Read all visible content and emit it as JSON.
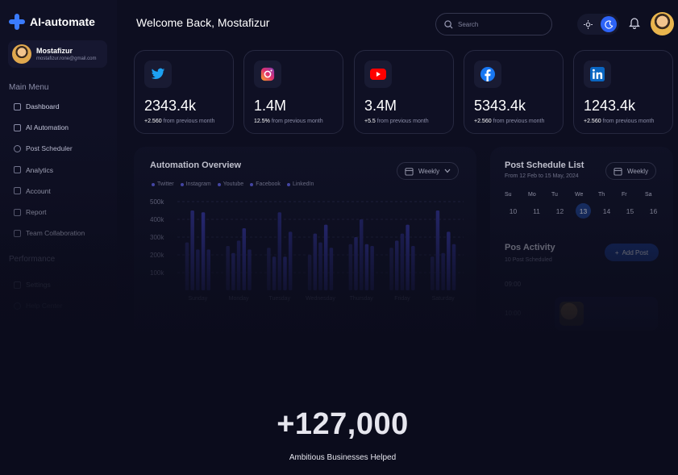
{
  "app": {
    "name": "AI-automate"
  },
  "profile": {
    "name": "Mostafizur",
    "email": "mostafizur.rone@gmail.com"
  },
  "menu": {
    "heading": "Main Menu",
    "items": [
      {
        "label": "Dashboard",
        "icon": "grid-icon"
      },
      {
        "label": "AI Automation",
        "icon": "tag-icon"
      },
      {
        "label": "Post Scheduler",
        "icon": "clock-icon"
      },
      {
        "label": "Analytics",
        "icon": "chart-icon"
      },
      {
        "label": "Account",
        "icon": "account-icon"
      },
      {
        "label": "Report",
        "icon": "report-icon"
      },
      {
        "label": "Team Collaboration",
        "icon": "team-icon"
      }
    ]
  },
  "perf": {
    "heading": "Performance",
    "items": [
      {
        "label": "Settings",
        "icon": "gear-icon"
      },
      {
        "label": "Help Center",
        "icon": "help-icon"
      }
    ]
  },
  "header": {
    "welcome": "Welcome Back, Mostafizur",
    "search_placeholder": "Search"
  },
  "stats": [
    {
      "platform": "twitter",
      "value": "2343.4k",
      "delta": "+2.560",
      "note": "from previous month",
      "color": "#1da1f2"
    },
    {
      "platform": "instagram",
      "value": "1.4M",
      "delta": "12.5%",
      "note": "from previous month",
      "color": "#e1306c"
    },
    {
      "platform": "youtube",
      "value": "3.4M",
      "delta": "+5.5",
      "note": "from previous month",
      "color": "#ff0000"
    },
    {
      "platform": "facebook",
      "value": "5343.4k",
      "delta": "+2.560",
      "note": "from previous month",
      "color": "#1877f2"
    },
    {
      "platform": "linkedin",
      "value": "1243.4k",
      "delta": "+2.560",
      "note": "from previous month",
      "color": "#0a66c2"
    }
  ],
  "overview": {
    "title": "Automation Overview",
    "range": "Weekly",
    "legend": [
      "Twitter",
      "Instagram",
      "Youtube",
      "Facebook",
      "LinkedIn"
    ],
    "yticks": [
      "500k",
      "400k",
      "300k",
      "200k",
      "100k"
    ],
    "xticks": [
      "Sunday",
      "Monday",
      "Tuesday",
      "Wednesday",
      "Thursday",
      "Friday",
      "Saturday"
    ]
  },
  "chart_data": {
    "type": "bar",
    "categories": [
      "Sunday",
      "Monday",
      "Tuesday",
      "Wednesday",
      "Thursday",
      "Friday",
      "Saturday"
    ],
    "series": [
      {
        "name": "Twitter",
        "values": [
          270,
          250,
          240,
          200,
          260,
          240,
          190
        ]
      },
      {
        "name": "Instagram",
        "values": [
          450,
          210,
          190,
          320,
          300,
          280,
          450
        ]
      },
      {
        "name": "Youtube",
        "values": [
          230,
          280,
          440,
          270,
          400,
          320,
          210
        ]
      },
      {
        "name": "Facebook",
        "values": [
          440,
          350,
          190,
          370,
          260,
          370,
          330
        ]
      },
      {
        "name": "LinkedIn",
        "values": [
          230,
          230,
          330,
          240,
          250,
          250,
          260
        ]
      }
    ],
    "ylim": [
      0,
      500
    ],
    "ylabel": "",
    "xlabel": ""
  },
  "schedule": {
    "title": "Post Schedule List",
    "subtitle": "From 12 Feb to 15 May, 2024",
    "range": "Weekly",
    "days": [
      "Su",
      "Mo",
      "Tu",
      "We",
      "Th",
      "Fr",
      "Sa"
    ],
    "dates": [
      "10",
      "11",
      "12",
      "13",
      "14",
      "15",
      "16"
    ],
    "selected_date": "13"
  },
  "activity": {
    "title": "Pos Activity",
    "subtitle": "10 Post Scheduled",
    "add_label": "Add Post",
    "times": [
      "09:00",
      "10:00"
    ]
  },
  "headline": {
    "number": "+127,000",
    "caption": "Ambitious Businesses Helped"
  }
}
